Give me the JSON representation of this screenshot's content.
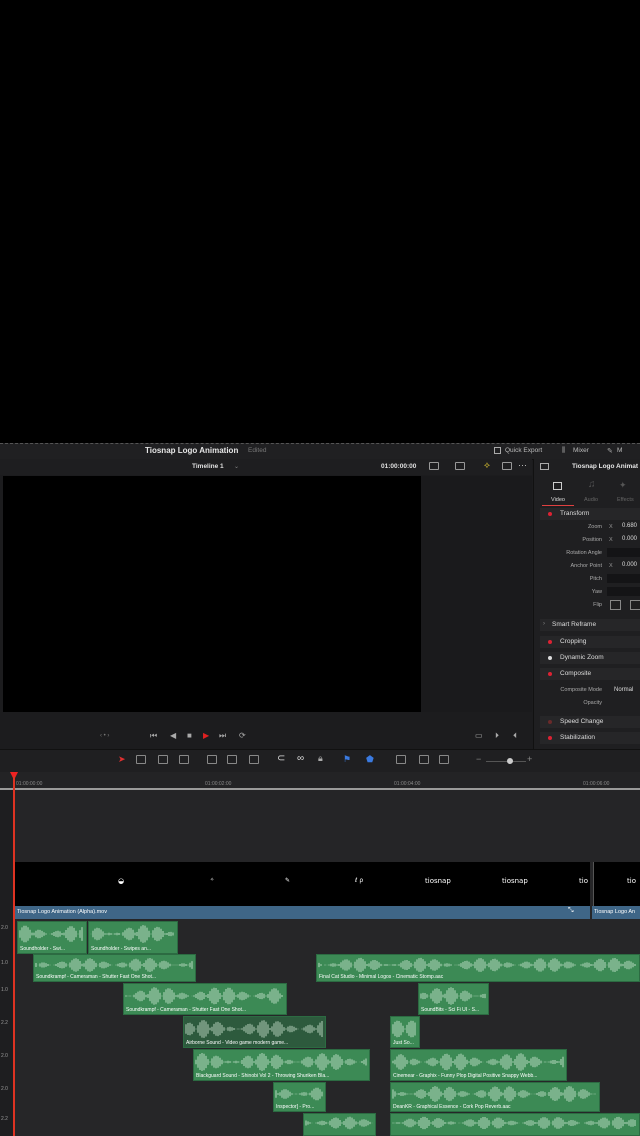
{
  "project": {
    "title": "Tiosnap Logo Animation",
    "status": "Edited"
  },
  "topbar": {
    "quick_export": "Quick Export",
    "mixer": "Mixer",
    "m_tab": "M"
  },
  "viewer": {
    "timeline_name": "Timeline 1",
    "timecode": "01:00:00:00"
  },
  "inspector": {
    "title": "Tiosnap Logo Animat",
    "tabs": [
      {
        "label": "Video"
      },
      {
        "label": "Audio"
      },
      {
        "label": "Effects"
      }
    ],
    "sections": {
      "transform": "Transform",
      "smart_reframe": "Smart Reframe",
      "cropping": "Cropping",
      "dynamic_zoom": "Dynamic Zoom",
      "composite": "Composite",
      "speed_change": "Speed Change",
      "stabilization": "Stabilization"
    },
    "props": {
      "zoom": "Zoom",
      "zoom_x": "X",
      "zoom_val": "0.680",
      "position": "Position",
      "position_x": "X",
      "position_val": "0.000",
      "rotation": "Rotation Angle",
      "anchor": "Anchor Point",
      "anchor_x": "X",
      "anchor_val": "0.000",
      "pitch": "Pitch",
      "yaw": "Yaw",
      "flip": "Flip",
      "composite_mode": "Composite Mode",
      "composite_mode_val": "Normal",
      "opacity": "Opacity"
    }
  },
  "ruler": {
    "ticks": [
      "01:00:00:00",
      "01:00:02:00",
      "01:00:04:00",
      "01:00:06:00"
    ]
  },
  "video_track": {
    "clip_label": "Tiosnap Logo Animation (Alpha).mov",
    "clip2_label": "Tiosnap Logo An",
    "thumbs": [
      "tiosnap",
      "tiosnap",
      "tio",
      "tio"
    ]
  },
  "track_numbers": [
    "2.0",
    "1.0",
    "1.0",
    "2.2",
    "2.0",
    "2.0",
    "2.2"
  ],
  "audio_clips": [
    {
      "label": "Soundholder - Swi..."
    },
    {
      "label": "Soundholder - Swipes an..."
    },
    {
      "label": "Soundkrampf - Cameraman - Shutter Fast One Shot..."
    },
    {
      "label": "Final Cat Studio - Minimal Logos - Cinematic Stomp.aac"
    },
    {
      "label": "Soundkrampf - Cameraman - Shutter Fast One Shot..."
    },
    {
      "label": "SoundBits - Sci Fi UI - S..."
    },
    {
      "label": "Airborne Sound - Video game modern game..."
    },
    {
      "label": "Just So..."
    },
    {
      "label": "Blackguard Sound - Shinobi Vol 2 - Throwing Shuriken Bla..."
    },
    {
      "label": "Cinemear - Graphix - Funny Plop Digital Positive Snappy Webb..."
    },
    {
      "label": "Inspector] - Pro..."
    },
    {
      "label": "DeanKR - Graphical Essence - Cork Pop Reverb.aac"
    }
  ],
  "colors": {
    "audio_clip": "#3c8a55",
    "video_label": "#3f6687",
    "playhead": "#dd2222"
  }
}
